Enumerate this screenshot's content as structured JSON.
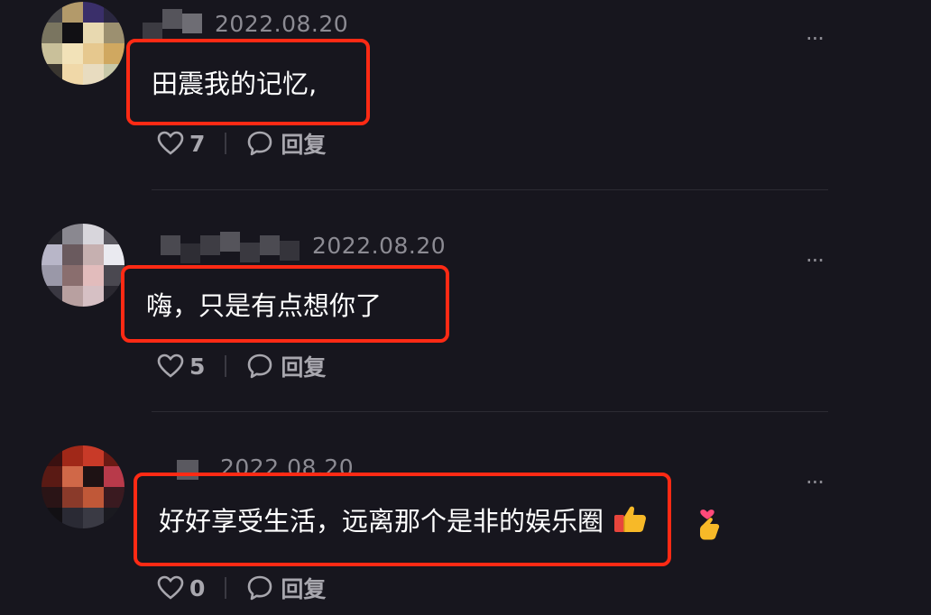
{
  "comments": [
    {
      "date": "2022.08.20",
      "text": "田震我的记忆,",
      "likes": "7",
      "reply_label": "回复",
      "more_label": "···"
    },
    {
      "date": "2022.08.20",
      "text": "嗨，只是有点想你了",
      "likes": "5",
      "reply_label": "回复",
      "more_label": "···"
    },
    {
      "date": "2022.08.20",
      "text": "好好享受生活，远离那个是非的娱乐圈",
      "likes": "0",
      "reply_label": "回复",
      "more_label": "···",
      "emojis": [
        "thumbs-up-emoji",
        "finger-heart-emoji"
      ]
    }
  ],
  "colors": {
    "background": "#17161e",
    "highlight_border": "#ff2a14",
    "muted_text": "#8c8b93"
  }
}
